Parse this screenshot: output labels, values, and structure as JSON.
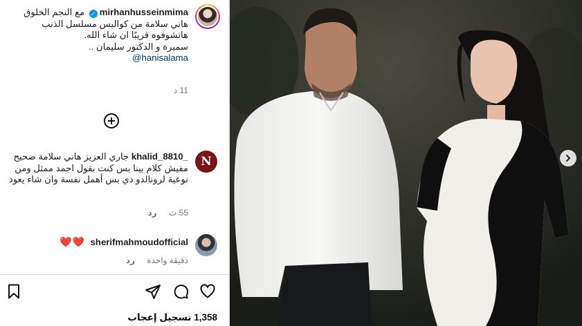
{
  "post": {
    "author": "mirhanhusseinmima",
    "caption_line1": "مع النجم",
    "caption_rest": "الخلوق هاني سلامة من كواليس مسلسل الذنب هاتشوفوه قريبًا ان شاء الله.",
    "caption_line3": "سميرة و الدكتور سليمان ..",
    "mention": "@hanisalama",
    "time": "11 د"
  },
  "comments": [
    {
      "username": "khalid_8810_",
      "text": "جاري العزيز هاني سلامة صحيح مفيش كلام بينا بس كنت بقول اجمد ممثل ومن نوعية لرونالدو دي بس أهمل نفسة وان شاء يعود",
      "time": "55 ث",
      "reply": "رد",
      "avatar_letter": "N"
    },
    {
      "username": "sherifmahmoudofficial",
      "text": "❤️❤️",
      "time": "دقيقة واحدة",
      "reply": "رد"
    }
  ],
  "actions": {
    "likes_count": "1,358",
    "likes_label": "تسجيل إعجاب"
  },
  "icons": {
    "verified": "verified-badge-icon",
    "add": "add-comment-icon",
    "like": "heart-icon",
    "comment": "comment-icon",
    "share": "send-icon",
    "save": "bookmark-icon",
    "next": "chevron-right-icon"
  },
  "colors": {
    "accent": "#0095f6",
    "mention": "#00376b",
    "heart": "#e0142b",
    "meta": "#737373"
  }
}
